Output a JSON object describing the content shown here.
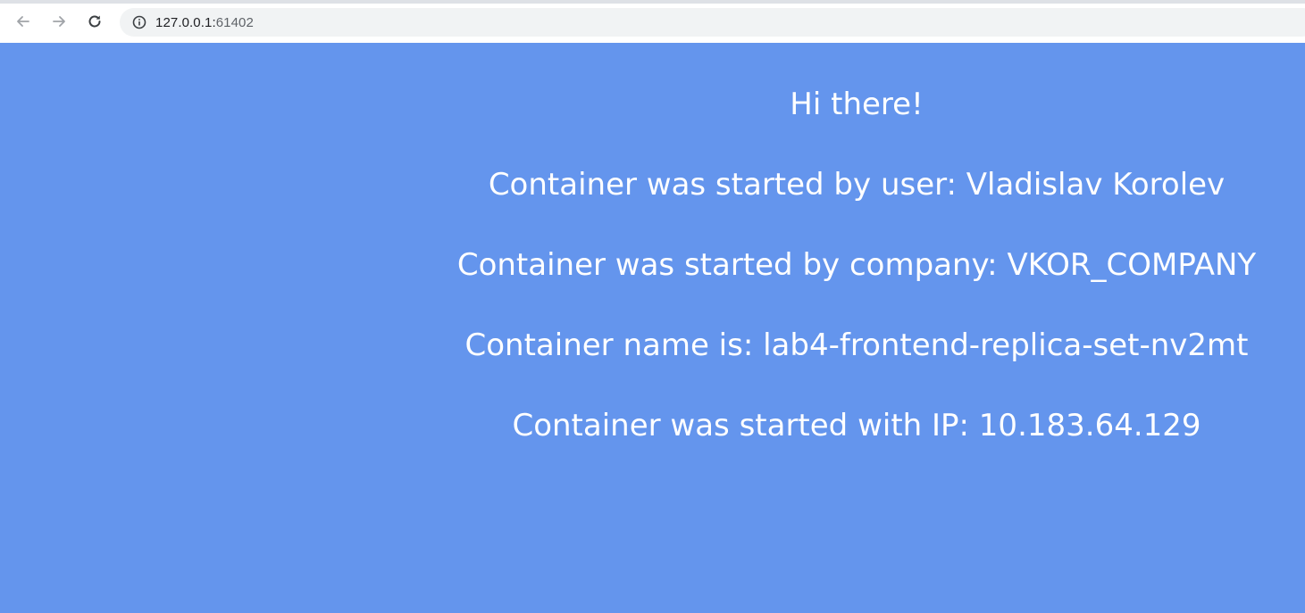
{
  "browser": {
    "url_host": "127.0.0.1:",
    "url_port": "61402",
    "icons": {
      "back": "arrow-left-icon",
      "forward": "arrow-right-icon",
      "reload": "reload-icon",
      "site_info": "info-icon"
    }
  },
  "page": {
    "background_color": "#6495ed",
    "text_color": "#ffffff",
    "greeting": "Hi there!",
    "lines": [
      "Container was started by user: Vladislav Korolev",
      "Container was started by company: VKOR_COMPANY",
      "Container name is: lab4-frontend-replica-set-nv2mt",
      "Container was started with IP: 10.183.64.129"
    ]
  }
}
